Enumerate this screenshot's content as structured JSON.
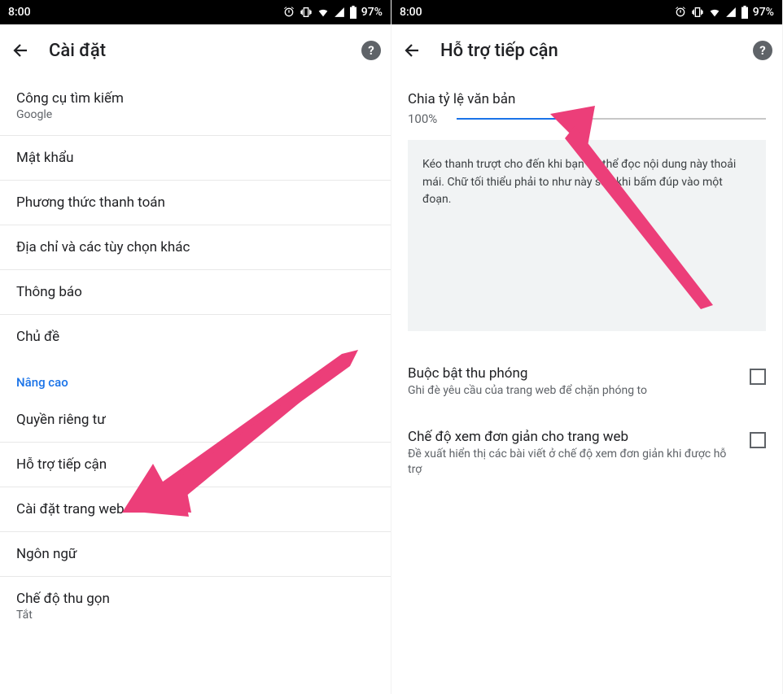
{
  "status": {
    "time": "8:00",
    "battery": "97%"
  },
  "left": {
    "title": "Cài đặt",
    "items": {
      "search_engine": {
        "label": "Công cụ tìm kiếm",
        "value": "Google"
      },
      "passwords": {
        "label": "Mật khẩu"
      },
      "payment": {
        "label": "Phương thức thanh toán"
      },
      "addresses": {
        "label": "Địa chỉ và các tùy chọn khác"
      },
      "notifications": {
        "label": "Thông báo"
      },
      "theme": {
        "label": "Chủ đề"
      }
    },
    "advanced_header": "Nâng cao",
    "advanced": {
      "privacy": {
        "label": "Quyền riêng tư"
      },
      "accessibility": {
        "label": "Hỗ trợ tiếp cận"
      },
      "site_settings": {
        "label": "Cài đặt trang web"
      },
      "language": {
        "label": "Ngôn ngữ"
      },
      "lite_mode": {
        "label": "Chế độ thu gọn",
        "value": "Tắt"
      }
    }
  },
  "right": {
    "title": "Hỗ trợ tiếp cận",
    "text_scaling": {
      "label": "Chia tỷ lệ văn bản",
      "percent": "100%",
      "fill_percent": 36
    },
    "hint": "Kéo thanh trượt cho đến khi bạn có thể đọc nội dung này thoải mái. Chữ tối thiểu phải to như này sau khi bấm đúp vào một đoạn.",
    "force_zoom": {
      "title": "Buộc bật thu phóng",
      "subtitle": "Ghi đè yêu cầu của trang web để chặn phóng to"
    },
    "simplified": {
      "title": "Chế độ xem đơn giản cho trang web",
      "subtitle": "Đề xuất hiển thị các bài viết ở chế độ xem đơn giản khi được hỗ trợ"
    }
  }
}
